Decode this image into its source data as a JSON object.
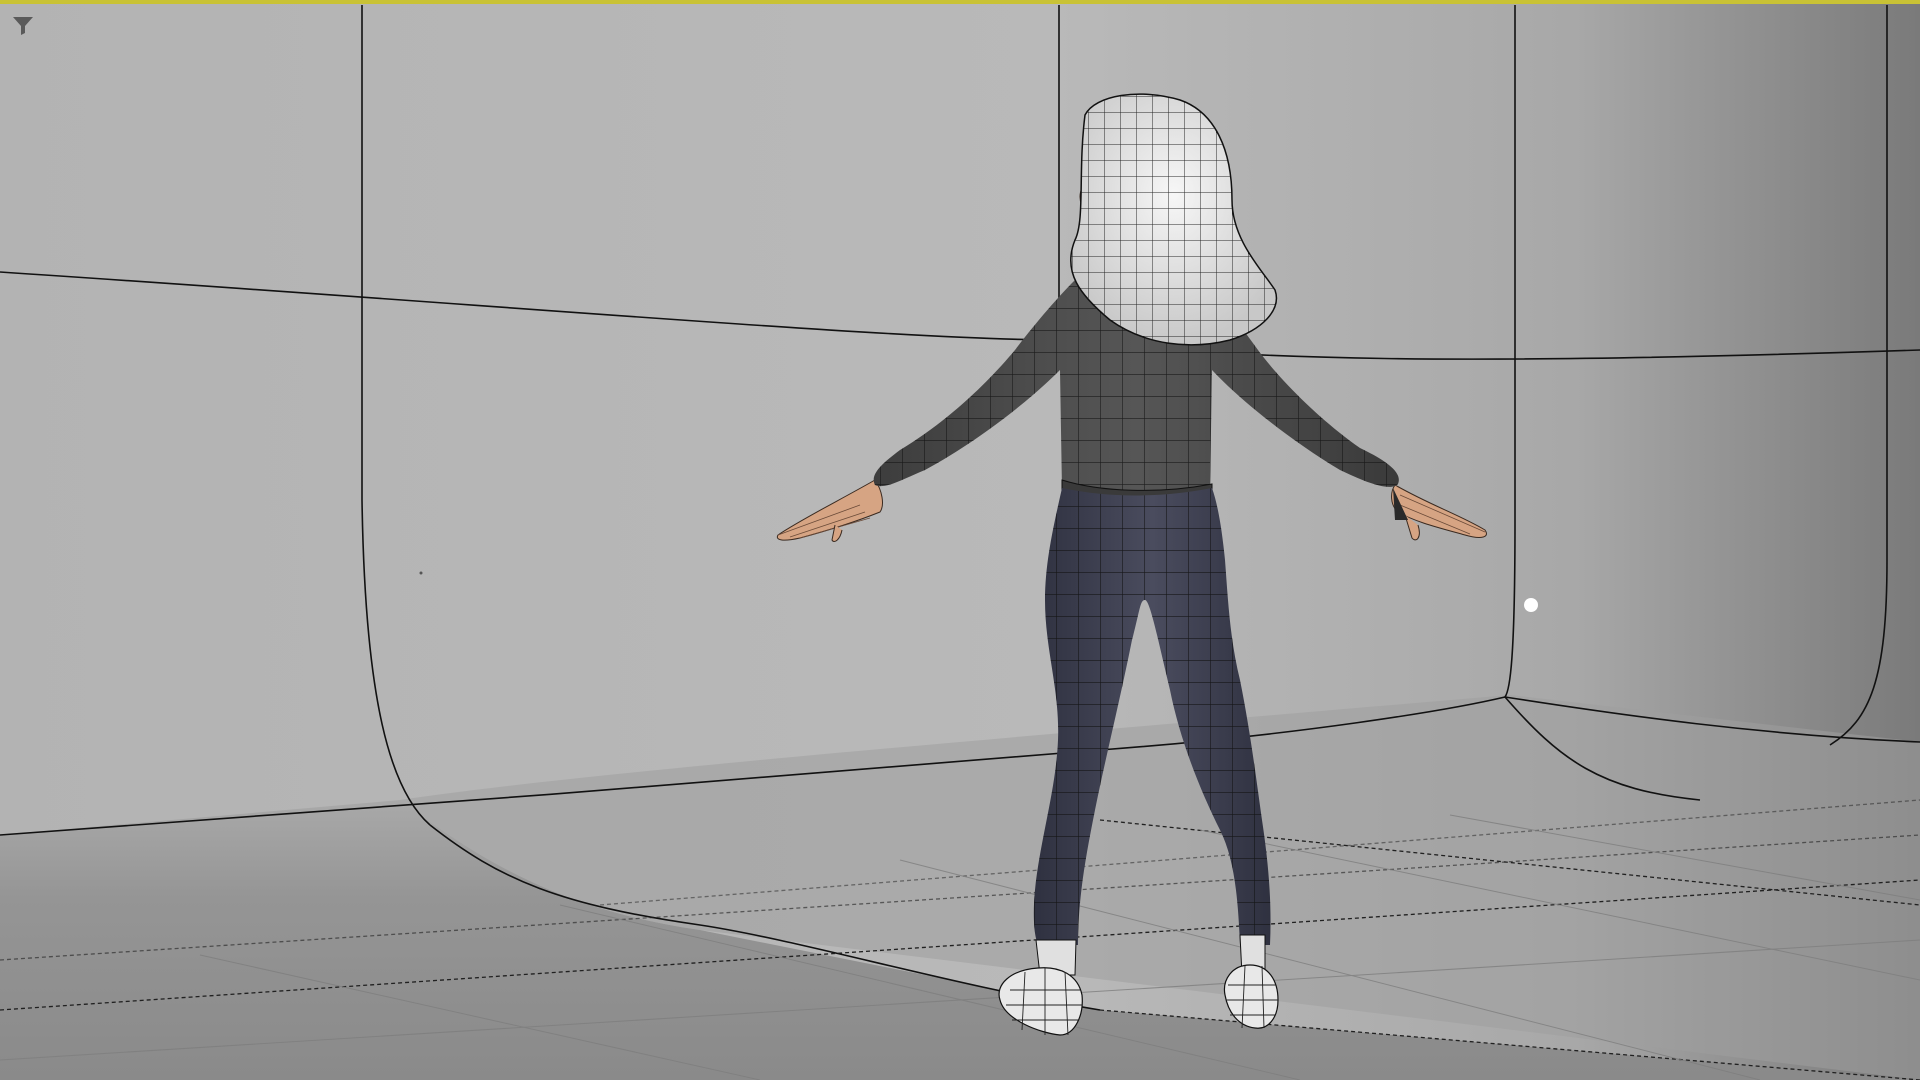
{
  "viewport": {
    "mode": "perspective",
    "shading": "smooth-shade-with-wireframe",
    "active_border_color": "#c9c235",
    "background_color": "#9c9c9c"
  },
  "toolbar": {
    "filter_icon": "filter-funnel-icon",
    "filter_icon_color": "#5a5a5a"
  },
  "scene": {
    "backdrop_color": "#b4b4b4",
    "floor_color": "#8e8e8e",
    "character": {
      "hair_color": "#ececec",
      "hoodie_color": "#4a4a4a",
      "pants_color": "#3b3d4d",
      "skin_color": "#d6a483",
      "shoe_color": "#e8e8e8",
      "wire_color": "#111111"
    },
    "light_icon": "point-light-icon"
  }
}
